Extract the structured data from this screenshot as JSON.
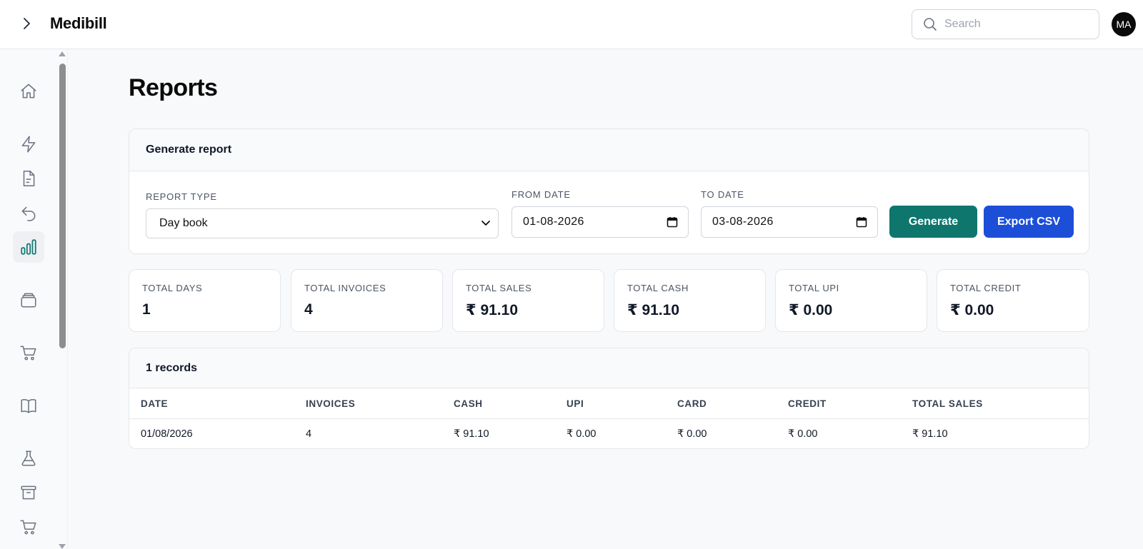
{
  "app": {
    "brand": "Medibill",
    "avatar_initials": "MA"
  },
  "search": {
    "placeholder": "Search"
  },
  "sidebar": {
    "items": [
      {
        "name": "home",
        "active": false
      },
      {
        "name": "quick-bill",
        "active": false
      },
      {
        "name": "invoices",
        "active": false
      },
      {
        "name": "returns",
        "active": false
      },
      {
        "name": "reports",
        "active": true
      },
      {
        "name": "inventory",
        "active": false
      },
      {
        "name": "purchases",
        "active": false
      },
      {
        "name": "ledger",
        "active": false
      },
      {
        "name": "lab",
        "active": false
      },
      {
        "name": "archive",
        "active": false
      },
      {
        "name": "orders",
        "active": false
      }
    ]
  },
  "page": {
    "title": "Reports"
  },
  "generate": {
    "title": "Generate report",
    "report_type_label": "REPORT TYPE",
    "report_type_value": "Day book",
    "from_label": "FROM DATE",
    "from_value": "01-08-2026",
    "to_label": "TO DATE",
    "to_value": "03-08-2026",
    "generate_button": "Generate",
    "export_button": "Export CSV"
  },
  "stats": [
    {
      "label": "TOTAL DAYS",
      "value": "1"
    },
    {
      "label": "TOTAL INVOICES",
      "value": "4"
    },
    {
      "label": "TOTAL SALES",
      "value": "₹ 91.10"
    },
    {
      "label": "TOTAL CASH",
      "value": "₹ 91.10"
    },
    {
      "label": "TOTAL UPI",
      "value": "₹ 0.00"
    },
    {
      "label": "TOTAL CREDIT",
      "value": "₹ 0.00"
    }
  ],
  "table": {
    "title": "1 records",
    "columns": [
      "DATE",
      "INVOICES",
      "CASH",
      "UPI",
      "CARD",
      "CREDIT",
      "TOTAL SALES"
    ],
    "rows": [
      [
        "01/08/2026",
        "4",
        "₹ 91.10",
        "₹ 0.00",
        "₹ 0.00",
        "₹ 0.00",
        "₹ 91.10"
      ]
    ]
  },
  "colors": {
    "generate": "#0f766e",
    "export": "#1d4ed8",
    "active_icon": "#0f766e"
  }
}
